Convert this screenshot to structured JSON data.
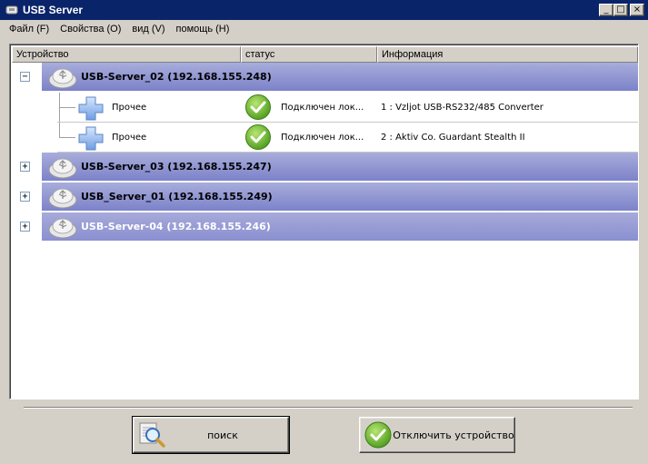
{
  "window": {
    "title": "USB Server",
    "min_symbol": "_",
    "max_symbol": "□",
    "close_symbol": "×"
  },
  "menu": [
    {
      "label": "Файл (F)"
    },
    {
      "label": "Свойства (O)"
    },
    {
      "label": "вид (V)"
    },
    {
      "label": "помощь (H)"
    }
  ],
  "columns": {
    "device": "Устройство",
    "status": "статус",
    "info": "Информация"
  },
  "servers": [
    {
      "label": "USB-Server_02  (192.168.155.248)",
      "expander": "−",
      "expanded": true,
      "devices": [
        {
          "name": "Прочее",
          "status": "Подключен лок...",
          "info": "1 : Vzljot USB-RS232/485 Converter"
        },
        {
          "name": "Прочее",
          "status": "Подключен лок...",
          "info": "2 : Aktiv Co. Guardant Stealth II"
        }
      ]
    },
    {
      "label": "USB-Server_03  (192.168.155.247)",
      "expander": "+",
      "expanded": false
    },
    {
      "label": "USB_Server_01  (192.168.155.249)",
      "expander": "+",
      "expanded": false
    },
    {
      "label": "USB-Server-04  (192.168.155.246)",
      "expander": "+",
      "expanded": false
    }
  ],
  "buttons": {
    "search": "поиск",
    "disconnect": "Отключить устройство"
  },
  "colors": {
    "titlebar": "#0a246a",
    "group_band": "#8f94d1",
    "status_ok": "#6cbb2a"
  }
}
